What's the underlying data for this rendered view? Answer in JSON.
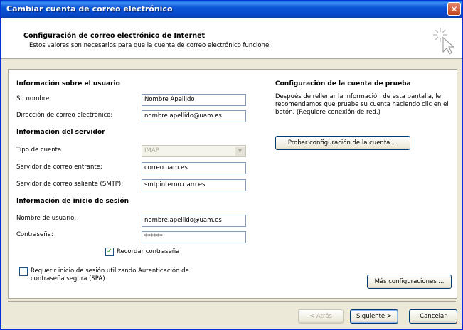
{
  "window": {
    "title": "Cambiar cuenta de correo electrónico",
    "close_glyph": "✕"
  },
  "header": {
    "title": "Configuración de correo electrónico de Internet",
    "subtitle": "Estos valores son necesarios para que la cuenta de correo electrónico funcione."
  },
  "user_info": {
    "heading": "Información sobre el usuario",
    "name_label": "Su nombre:",
    "name_value": "Nombre Apellido",
    "email_label": "Dirección de correo electrónico:",
    "email_value": "nombre.apellido@uam.es"
  },
  "server_info": {
    "heading": "Información del servidor",
    "account_type_label": "Tipo de cuenta",
    "account_type_value": "IMAP",
    "incoming_label": "Servidor de correo entrante:",
    "incoming_value": "correo.uam.es",
    "outgoing_label": "Servidor de correo saliente (SMTP):",
    "outgoing_value": "smtpinterno.uam.es"
  },
  "login_info": {
    "heading": "Información de inicio de sesión",
    "username_label": "Nombre de usuario:",
    "username_value": "nombre.apellido@uam.es",
    "password_label": "Contraseña:",
    "password_value": "******",
    "remember_label": "Recordar contraseña",
    "remember_checked": true
  },
  "spa": {
    "label": "Requerir inicio de sesión utilizando Autenticación de contraseña segura (SPA)",
    "checked": false
  },
  "test": {
    "heading": "Configuración de la cuenta de prueba",
    "description": "Después de rellenar la información de esta pantalla, le recomendamos que pruebe su cuenta haciendo clic en el botón. (Requiere conexión de red.)",
    "button": "Probar configuración de la cuenta ..."
  },
  "more_settings_button": "Más configuraciones ...",
  "footer": {
    "back": "< Atrás",
    "next": "Siguiente >",
    "cancel": "Cancelar"
  },
  "colors": {
    "title_bar": "#0b56d8",
    "dialog_bg": "#ece9d8",
    "field_border": "#7f9db9"
  },
  "icons": {
    "header": "cursor-sparkle-icon",
    "close": "close-icon",
    "dropdown": "chevron-down-icon",
    "check": "checkmark-icon"
  }
}
